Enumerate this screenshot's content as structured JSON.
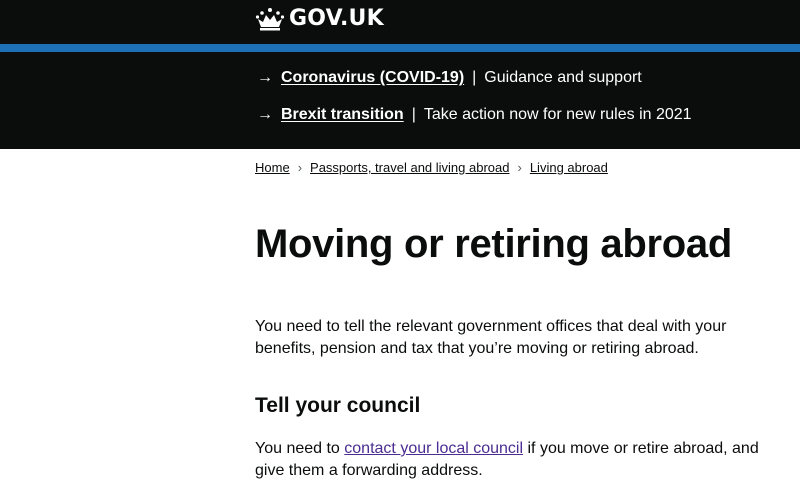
{
  "header": {
    "logo_text": "GOV.UK",
    "colors": {
      "header_bg": "#0b0c0c",
      "accent_bar": "#1d70b8"
    }
  },
  "notices": [
    {
      "link": "Coronavirus (COVID-19)",
      "separator": "|",
      "description": "Guidance and support"
    },
    {
      "link": "Brexit transition",
      "separator": "|",
      "description": "Take action now for new rules in 2021"
    }
  ],
  "breadcrumbs": [
    "Home",
    "Passports, travel and living abroad",
    "Living abroad"
  ],
  "main": {
    "title": "Moving or retiring abroad",
    "lead": "You need to tell the relevant government offices that deal with your benefits, pension and tax that you’re moving or retiring abroad.",
    "section_heading": "Tell your council",
    "section_text_before": "You need to ",
    "section_link": "contact your local council",
    "section_text_after": " if you move or retire abroad, and give them a forwarding address."
  }
}
